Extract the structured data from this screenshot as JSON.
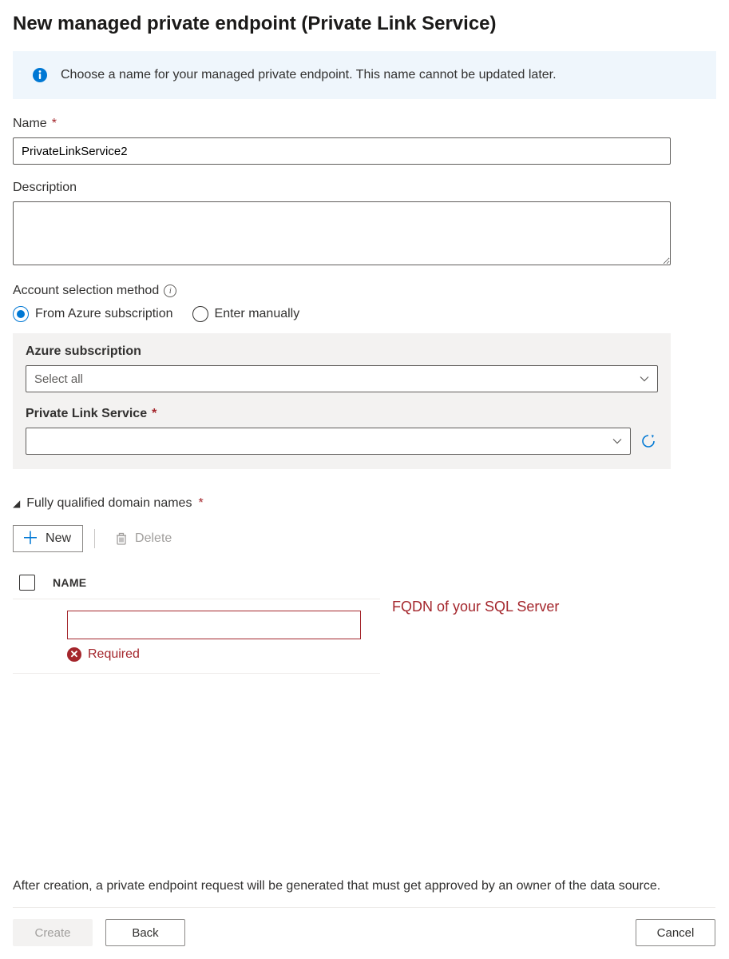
{
  "pageTitle": "New managed private endpoint (Private Link Service)",
  "infoBox": {
    "text": "Choose a name for your managed private endpoint. This name cannot be updated later."
  },
  "fields": {
    "name": {
      "label": "Name",
      "value": "PrivateLinkService2"
    },
    "description": {
      "label": "Description",
      "value": ""
    },
    "accountMethod": {
      "label": "Account selection method",
      "options": {
        "fromSubscription": "From Azure subscription",
        "enterManually": "Enter manually"
      },
      "selected": "fromSubscription"
    },
    "azureSubscription": {
      "label": "Azure subscription",
      "value": "Select all"
    },
    "privateLinkService": {
      "label": "Private Link Service",
      "value": ""
    }
  },
  "fqdn": {
    "sectionLabel": "Fully qualified domain names",
    "newBtn": "New",
    "deleteBtn": "Delete",
    "columnHeader": "NAME",
    "errorMsg": "Required",
    "annotation": "FQDN of your SQL Server"
  },
  "footerNote": "After creation, a private endpoint request will be generated that must get approved by an owner of the data source.",
  "buttons": {
    "create": "Create",
    "back": "Back",
    "cancel": "Cancel"
  }
}
